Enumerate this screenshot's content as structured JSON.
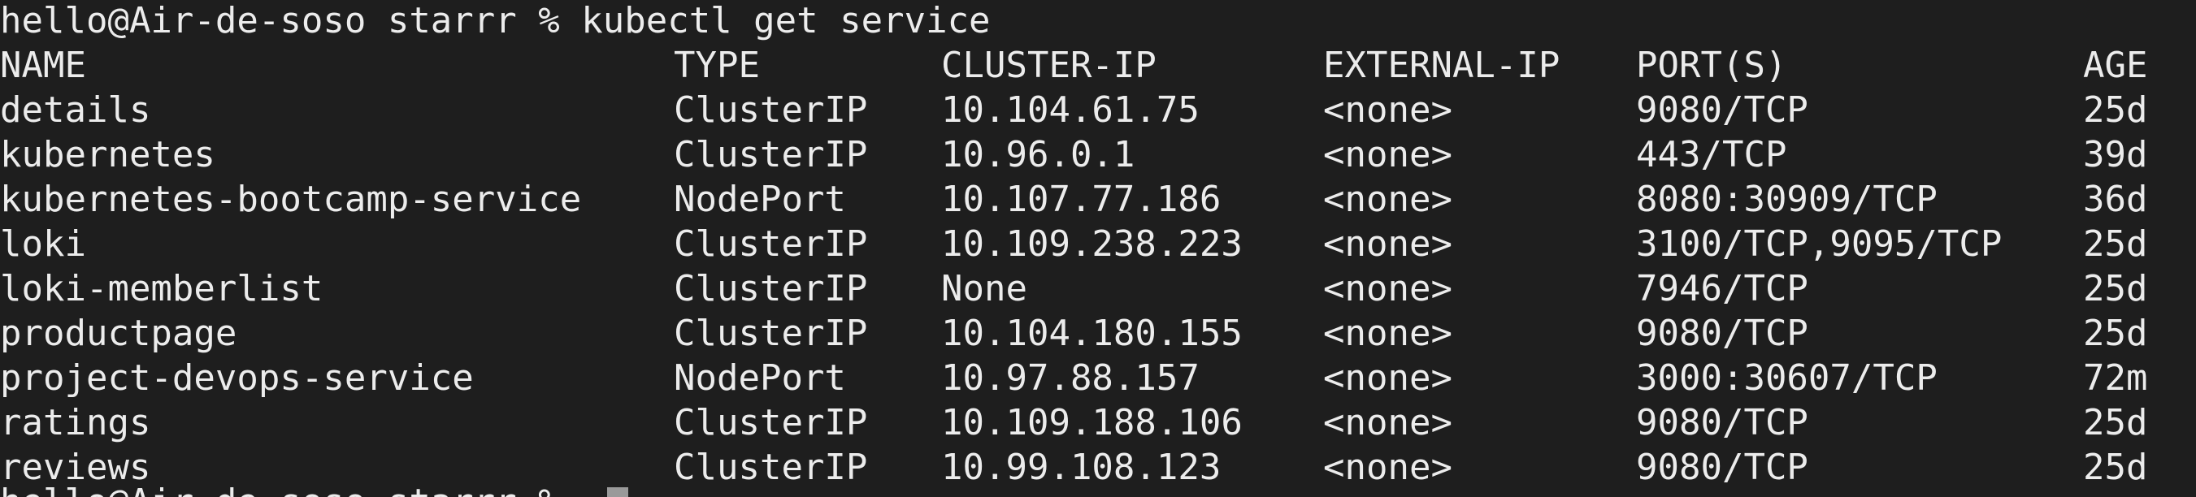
{
  "terminal": {
    "prompt_line": "hello@Air-de-soso starrr % kubectl get service",
    "header": {
      "name": "NAME",
      "type": "TYPE",
      "cluster_ip": "CLUSTER-IP",
      "external_ip": "EXTERNAL-IP",
      "ports": "PORT(S)",
      "age": "AGE"
    },
    "rows": [
      {
        "name": "details",
        "type": "ClusterIP",
        "cluster_ip": "10.104.61.75",
        "external_ip": "<none>",
        "ports": "9080/TCP",
        "age": "25d"
      },
      {
        "name": "kubernetes",
        "type": "ClusterIP",
        "cluster_ip": "10.96.0.1",
        "external_ip": "<none>",
        "ports": "443/TCP",
        "age": "39d"
      },
      {
        "name": "kubernetes-bootcamp-service",
        "type": "NodePort",
        "cluster_ip": "10.107.77.186",
        "external_ip": "<none>",
        "ports": "8080:30909/TCP",
        "age": "36d"
      },
      {
        "name": "loki",
        "type": "ClusterIP",
        "cluster_ip": "10.109.238.223",
        "external_ip": "<none>",
        "ports": "3100/TCP,9095/TCP",
        "age": "25d"
      },
      {
        "name": "loki-memberlist",
        "type": "ClusterIP",
        "cluster_ip": "None",
        "external_ip": "<none>",
        "ports": "7946/TCP",
        "age": "25d"
      },
      {
        "name": "productpage",
        "type": "ClusterIP",
        "cluster_ip": "10.104.180.155",
        "external_ip": "<none>",
        "ports": "9080/TCP",
        "age": "25d"
      },
      {
        "name": "project-devops-service",
        "type": "NodePort",
        "cluster_ip": "10.97.88.157",
        "external_ip": "<none>",
        "ports": "3000:30607/TCP",
        "age": "72m"
      },
      {
        "name": "ratings",
        "type": "ClusterIP",
        "cluster_ip": "10.109.188.106",
        "external_ip": "<none>",
        "ports": "9080/TCP",
        "age": "25d"
      },
      {
        "name": "reviews",
        "type": "ClusterIP",
        "cluster_ip": "10.99.108.123",
        "external_ip": "<none>",
        "ports": "9080/TCP",
        "age": "25d"
      }
    ],
    "next_prompt_partial": "hello@Air-de-soso starrr %"
  }
}
